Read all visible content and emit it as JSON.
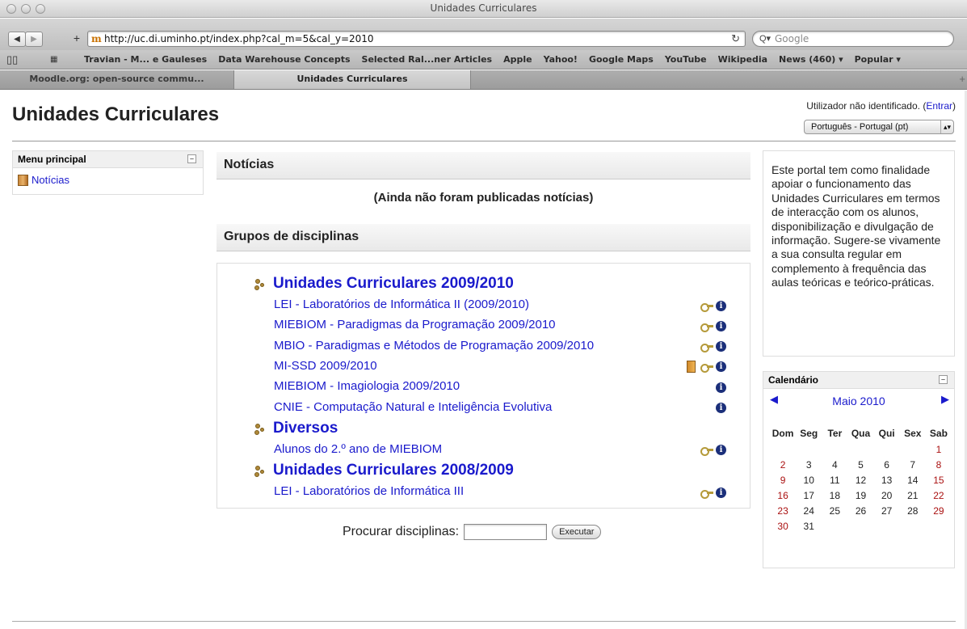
{
  "browser": {
    "window_title": "Unidades Curriculares",
    "url": "http://uc.di.uminho.pt/index.php?cal_m=5&cal_y=2010",
    "search_placeholder": "Google",
    "bookmarks": [
      "Travian - M... e Gauleses",
      "Data Warehouse Concepts",
      "Selected Ral...ner Articles",
      "Apple",
      "Yahoo!",
      "Google Maps",
      "YouTube",
      "Wikipedia",
      "News (460) ▾",
      "Popular ▾"
    ],
    "tabs": [
      "Moodle.org: open-source commu...",
      "Unidades Curriculares"
    ],
    "active_tab": 1
  },
  "header": {
    "title": "Unidades Curriculares",
    "login_text": "Utilizador não identificado. (",
    "login_link": "Entrar",
    "login_close": ")",
    "language": "Português - Portugal (pt)"
  },
  "menu": {
    "title": "Menu principal",
    "items": [
      {
        "label": "Notícias"
      }
    ]
  },
  "news": {
    "title": "Notícias",
    "empty_text": "(Ainda não foram publicadas notícias)"
  },
  "groups": {
    "title": "Grupos de disciplinas",
    "categories": [
      {
        "name": "Unidades Curriculares 2009/2010",
        "courses": [
          {
            "name": "LEI - Laboratórios de Informática II (2009/2010)",
            "icons": [
              "key",
              "info"
            ]
          },
          {
            "name": "MIEBIOM - Paradigmas da Programação 2009/2010",
            "icons": [
              "key",
              "info"
            ]
          },
          {
            "name": "MBIO - Paradigmas e Métodos de Programação 2009/2010",
            "icons": [
              "key",
              "info"
            ]
          },
          {
            "name": "MI-SSD 2009/2010",
            "icons": [
              "door",
              "key",
              "info"
            ]
          },
          {
            "name": "MIEBIOM - Imagiologia 2009/2010",
            "icons": [
              "info"
            ]
          },
          {
            "name": "CNIE - Computação Natural e Inteligência Evolutiva",
            "icons": [
              "info"
            ]
          }
        ]
      },
      {
        "name": "Diversos",
        "courses": [
          {
            "name": "Alunos do 2.º ano de MIEBIOM",
            "icons": [
              "key",
              "info"
            ]
          }
        ]
      },
      {
        "name": "Unidades Curriculares 2008/2009",
        "courses": [
          {
            "name": "LEI - Laboratórios de Informática III",
            "icons": [
              "key",
              "info"
            ]
          }
        ]
      }
    ]
  },
  "search": {
    "label": "Procurar disciplinas:",
    "value": "",
    "button": "Executar"
  },
  "info_block": {
    "text": "Este portal tem como finalidade apoiar o funcionamento das Unidades Curriculares em termos de interacção com os alunos, disponibilização e divulgação de informação. Sugere-se vivamente a sua consulta regular em complemento à frequência das aulas teóricas e teórico-práticas."
  },
  "calendar": {
    "title": "Calendário",
    "month": "Maio 2010",
    "weekdays": [
      "Dom",
      "Seg",
      "Ter",
      "Qua",
      "Qui",
      "Sex",
      "Sab"
    ],
    "first_weekday_index": 6,
    "days_in_month": 31,
    "weekend_color": "#aa1111"
  }
}
